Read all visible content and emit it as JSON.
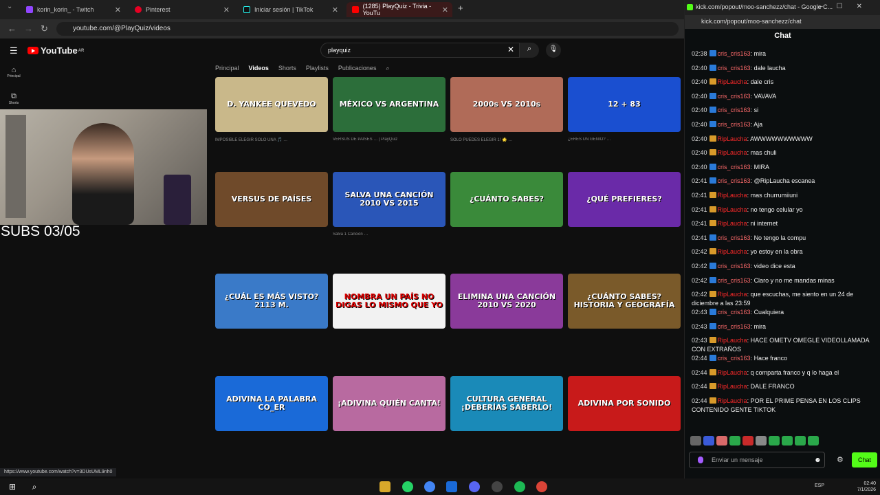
{
  "browser": {
    "tabs": [
      {
        "label": "korin_korin_ - Twitch",
        "color": "#9146ff"
      },
      {
        "label": "Pinterest",
        "color": "#e60023"
      },
      {
        "label": "Iniciar sesión | TikTok",
        "color": "#222222"
      },
      {
        "label": "(1285) PlayQuiz - Trivia - YouTu",
        "color": "#ff0000"
      }
    ],
    "new_tab": "+",
    "url": "youtube.com/@PlayQuiz/videos",
    "status_url": "https://www.youtube.com/watch?v=3DUsUML9nh0"
  },
  "youtube": {
    "logo": "YouTube",
    "country": "AR",
    "search_value": "playquiz",
    "sidenav": [
      {
        "icon": "home-icon",
        "glyph": "⌂",
        "label": "Principal"
      },
      {
        "icon": "shorts-icon",
        "glyph": "⧉",
        "label": "Shorts"
      }
    ],
    "channel_tabs": [
      "Principal",
      "Videos",
      "Shorts",
      "Playlists",
      "Publicaciones"
    ],
    "active_tab": "Videos"
  },
  "videos": [
    {
      "thumb_text": "D. YANKEE  QUEVEDO",
      "bg": "#c9b88a",
      "meta": "IMPOSIBLE ELEGIR SOLO UNA 🎵 …"
    },
    {
      "thumb_text": "MÉXICO VS ARGENTINA",
      "bg": "#2c6e3a",
      "meta": "VERSUS DE PAÍSES … | PlayQuiz"
    },
    {
      "thumb_text": "2000s VS 2010s",
      "bg": "#b06b58",
      "meta": "SOLO PUEDES ELEGIR 1! 🌟 …"
    },
    {
      "thumb_text": "12 + 83",
      "bg": "#1a4fd0",
      "meta": "¿ERES UN GENIO? …"
    },
    {
      "thumb_text": "VERSUS DE PAÍSES",
      "bg": "#6f4a2a",
      "meta": ""
    },
    {
      "thumb_text": "SALVA UNA CANCIÓN  2010 VS 2015",
      "bg": "#2a56b8",
      "meta": "Salva 1 Canción …"
    },
    {
      "thumb_text": "¿CUÁNTO SABES?",
      "bg": "#3a8a3a",
      "meta": ""
    },
    {
      "thumb_text": "¿QUÉ PREFIERES?",
      "bg": "#6a2aa8",
      "meta": ""
    },
    {
      "thumb_text": "¿CUÁL ES MÁS VISTO?  2113 M.",
      "bg": "#3a7ac8",
      "meta": ""
    },
    {
      "thumb_text": "NOMBRA UN PAÍS  NO DIGAS LO MISMO QUE YO",
      "bg": "#f2f2f2",
      "meta": ""
    },
    {
      "thumb_text": "ELIMINA UNA CANCIÓN  2010 VS 2020",
      "bg": "#8a3a9a",
      "meta": ""
    },
    {
      "thumb_text": "¿CUÁNTO SABES? HISTORIA Y GEOGRAFÍA",
      "bg": "#7a5a2a",
      "meta": ""
    },
    {
      "thumb_text": "ADIVINA LA PALABRA  CO_ER",
      "bg": "#1a6ad8",
      "meta": ""
    },
    {
      "thumb_text": "¡ADIVINA QUIÉN CANTA!",
      "bg": "#b86aa0",
      "meta": ""
    },
    {
      "thumb_text": "CULTURA GENERAL ¡DEBERÍAS SABERLO!",
      "bg": "#1a8ab8",
      "meta": ""
    },
    {
      "thumb_text": "ADIVINA POR SONIDO",
      "bg": "#c81a1a",
      "meta": ""
    }
  ],
  "overlay": {
    "subs": "SUBS 03/05"
  },
  "chat": {
    "window_title": "kick.com/popout/moo-sanchezz/chat - Google C...",
    "url": "kick.com/popout/moo-sanchezz/chat",
    "header": "Chat",
    "messages": [
      {
        "time": "02:38",
        "user": "cris_cris163",
        "text": "mira",
        "style": "u1"
      },
      {
        "time": "02:40",
        "user": "cris_cris163",
        "text": "dale laucha",
        "style": "u1"
      },
      {
        "time": "02:40",
        "user": "RipLaucha",
        "text": "dale cris",
        "style": "u2"
      },
      {
        "time": "02:40",
        "user": "cris_cris163",
        "text": "VAVAVA",
        "style": "u1"
      },
      {
        "time": "02:40",
        "user": "cris_cris163",
        "text": "si",
        "style": "u1"
      },
      {
        "time": "02:40",
        "user": "cris_cris163",
        "text": "Aja",
        "style": "u1"
      },
      {
        "time": "02:40",
        "user": "RipLaucha",
        "text": "AWWWWWWWWWW",
        "style": "u2"
      },
      {
        "time": "02:40",
        "user": "RipLaucha",
        "text": "mas chuli",
        "style": "u2"
      },
      {
        "time": "02:40",
        "user": "cris_cris163",
        "text": "MIRA",
        "style": "u1"
      },
      {
        "time": "02:41",
        "user": "cris_cris163",
        "text": "@RipLaucha escanea",
        "style": "u1"
      },
      {
        "time": "02:41",
        "user": "RipLaucha",
        "text": "mas churrumiiuni",
        "style": "u2"
      },
      {
        "time": "02:41",
        "user": "RipLaucha",
        "text": "no tengo celular yo",
        "style": "u2"
      },
      {
        "time": "02:41",
        "user": "RipLaucha",
        "text": "ni internet",
        "style": "u2"
      },
      {
        "time": "02:41",
        "user": "cris_cris163",
        "text": "No tengo la compu",
        "style": "u1"
      },
      {
        "time": "02:42",
        "user": "RipLaucha",
        "text": "yo estoy en la obra",
        "style": "u2"
      },
      {
        "time": "02:42",
        "user": "cris_cris163",
        "text": "video dice esta",
        "style": "u1"
      },
      {
        "time": "02:42",
        "user": "cris_cris163",
        "text": "Claro y no me mandas minas",
        "style": "u1"
      },
      {
        "time": "02:42",
        "user": "RipLaucha",
        "text": "que escuchas, me siento en un 24 de diciembre a las 23:59",
        "style": "u2"
      },
      {
        "time": "02:43",
        "user": "cris_cris163",
        "text": "Cualquiera",
        "style": "u1"
      },
      {
        "time": "02:43",
        "user": "cris_cris163",
        "text": "mira",
        "style": "u1"
      },
      {
        "time": "02:43",
        "user": "RipLaucha",
        "text": "HACE OMETV OMEGLE VIDEOLLAMADA CON EXTRAÑOS",
        "style": "u2"
      },
      {
        "time": "02:44",
        "user": "cris_cris163",
        "text": "Hace franco",
        "style": "u1"
      },
      {
        "time": "02:44",
        "user": "RipLaucha",
        "text": "q comparta franco y q lo haga el",
        "style": "u2"
      },
      {
        "time": "02:44",
        "user": "RipLaucha",
        "text": "DALE FRANCO",
        "style": "u2"
      },
      {
        "time": "02:44",
        "user": "RipLaucha",
        "text": "POR EL PRIME PENSA EN LOS CLIPS CONTENIDO GENTE TIKTOK",
        "style": "u2"
      }
    ],
    "input_placeholder": "Enviar un mensaje",
    "send_label": "Chat"
  },
  "taskbar": {
    "lang": "ESP",
    "time": "02:40",
    "date": "7/1/2026"
  },
  "colors": {
    "kick_green": "#53fc18",
    "youtube_red": "#ff0000"
  }
}
